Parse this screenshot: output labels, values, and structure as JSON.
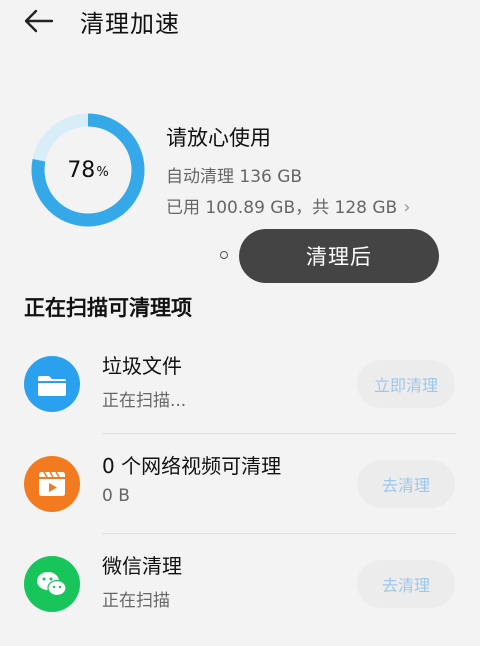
{
  "header": {
    "title": "清理加速",
    "back_icon": "arrow-left-icon"
  },
  "storage": {
    "percent": 78,
    "percent_value": "78",
    "percent_sign": "%",
    "status": "请放心使用",
    "auto_clean": "自动清理 136 GB",
    "used": "已用 100.89 GB，共 128 GB",
    "ring_color": "#35a9e8",
    "ring_track_color": "#d9edf9"
  },
  "after_button": "清理后",
  "scan_section": {
    "title": "正在扫描可清理项",
    "items": [
      {
        "name": "垃圾文件",
        "sub": "正在扫描...",
        "action": "立即清理",
        "icon": "folder-icon",
        "color": "#2aa1ef"
      },
      {
        "name": "0 个网络视频可清理",
        "sub": "0 B",
        "action": "去清理",
        "icon": "video-icon",
        "color": "#f37b1f"
      },
      {
        "name": "微信清理",
        "sub": "正在扫描",
        "action": "去清理",
        "icon": "wechat-icon",
        "color": "#17c55b"
      }
    ]
  }
}
